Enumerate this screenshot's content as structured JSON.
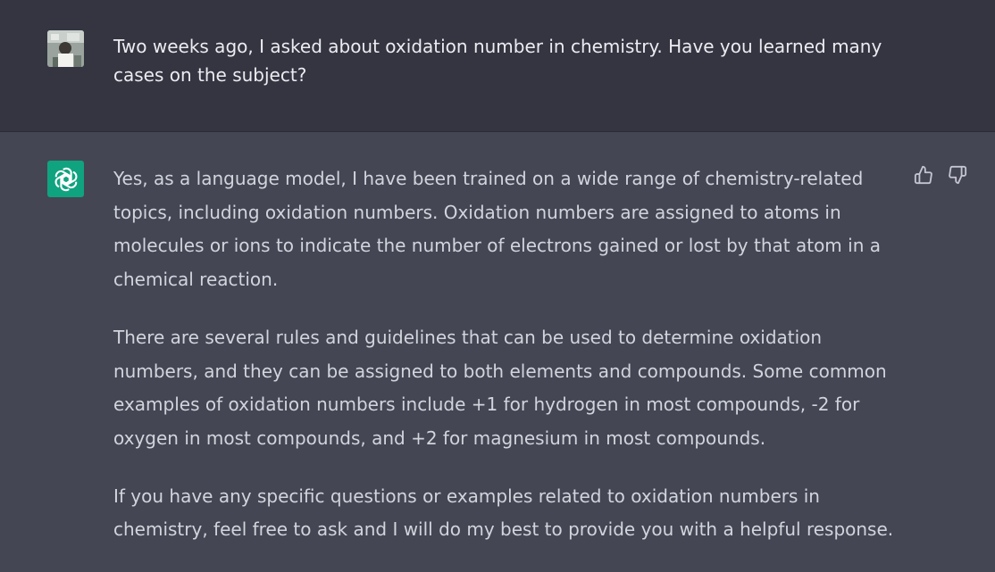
{
  "user_message": {
    "text": "Two weeks ago, I asked about oxidation number in chemistry. Have you learned many cases on the subject?"
  },
  "assistant_message": {
    "paragraphs": [
      "Yes, as a language model, I have been trained on a wide range of chemistry-related topics, including oxidation numbers. Oxidation numbers are assigned to atoms in molecules or ions to indicate the number of electrons gained or lost by that atom in a chemical reaction.",
      "There are several rules and guidelines that can be used to determine oxidation numbers, and they can be assigned to both elements and compounds. Some common examples of oxidation numbers include +1 for hydrogen in most compounds, -2 for oxygen in most compounds, and +2 for magnesium in most compounds.",
      "If you have any specific questions or examples related to oxidation numbers in chemistry, feel free to ask and I will do my best to provide you with a helpful response."
    ]
  },
  "icons": {
    "bot_avatar": "openai-logo-icon",
    "thumbs_up": "thumbs-up-icon",
    "thumbs_down": "thumbs-down-icon"
  },
  "colors": {
    "user_bg": "#343541",
    "assistant_bg": "#444654",
    "bot_avatar_bg": "#10a37f",
    "text": "#d1d5db"
  }
}
